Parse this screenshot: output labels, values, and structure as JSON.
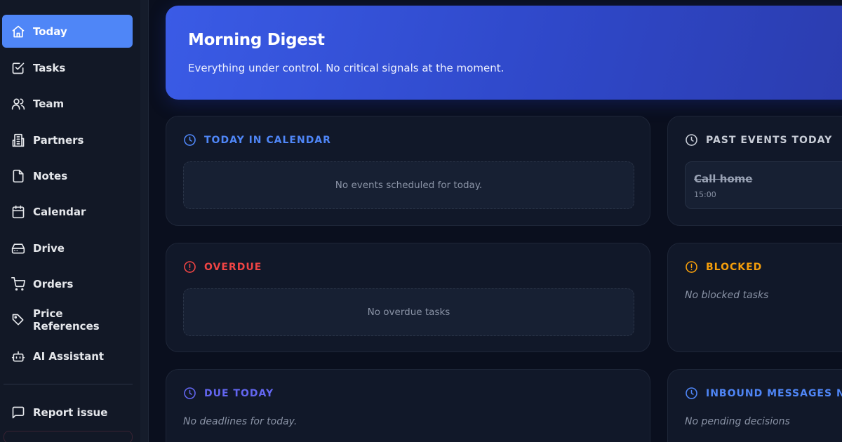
{
  "sidebar": {
    "items": [
      {
        "label": "Today",
        "icon": "home-icon",
        "active": true
      },
      {
        "label": "Tasks",
        "icon": "checkbox-icon"
      },
      {
        "label": "Team",
        "icon": "users-icon"
      },
      {
        "label": "Partners",
        "icon": "building-icon"
      },
      {
        "label": "Notes",
        "icon": "note-icon"
      },
      {
        "label": "Calendar",
        "icon": "calendar-icon"
      },
      {
        "label": "Drive",
        "icon": "drive-icon"
      },
      {
        "label": "Orders",
        "icon": "cart-icon"
      },
      {
        "label": "Price References",
        "icon": "tags-icon"
      },
      {
        "label": "AI Assistant",
        "icon": "bot-icon"
      }
    ],
    "footer": {
      "report_label": "Report issue",
      "icon": "message-icon"
    }
  },
  "hero": {
    "title": "Morning Digest",
    "subtitle": "Everything under control. No critical signals at the moment."
  },
  "cards": {
    "today_calendar": {
      "title": "TODAY IN CALENDAR",
      "empty": "No events scheduled for today.",
      "color": "#4f86f7"
    },
    "past_events": {
      "title": "PAST EVENTS TODAY",
      "color": "#c7ccd6",
      "events": [
        {
          "title": "Call home",
          "time": "15:00"
        }
      ]
    },
    "overdue": {
      "title": "OVERDUE",
      "empty": "No overdue tasks",
      "color": "#ef4444"
    },
    "blocked": {
      "title": "BLOCKED",
      "empty": "No blocked tasks",
      "color": "#f59e0b"
    },
    "due_today": {
      "title": "DUE TODAY",
      "empty": "No deadlines for today.",
      "color": "#6366f1"
    },
    "inbound": {
      "title": "INBOUND MESSAGES NEED",
      "empty": "No pending decisions",
      "color": "#4f86f7"
    }
  },
  "colors": {
    "accent": "#4f86f7",
    "background": "#0a0f1e",
    "card": "#111829"
  }
}
